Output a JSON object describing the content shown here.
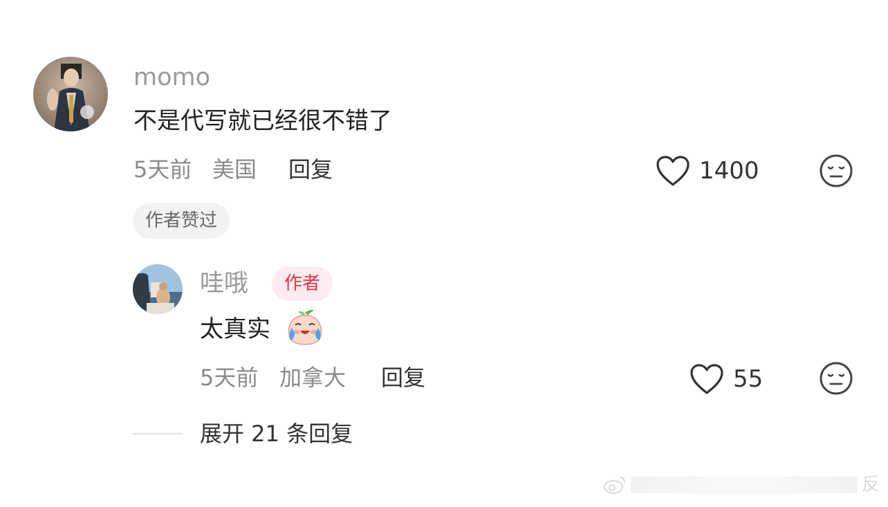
{
  "comment": {
    "username": "momo",
    "text": "不是代写就已经很不错了",
    "time": "5天前",
    "location": "美国",
    "reply_label": "回复",
    "like_count": "1400",
    "author_liked_badge": "作者赞过"
  },
  "reply": {
    "username": "哇哦",
    "author_badge": "作者",
    "text": "太真实",
    "time": "5天前",
    "location": "加拿大",
    "reply_label": "回复",
    "like_count": "55"
  },
  "expand_replies": {
    "label": "展开 21 条回复"
  },
  "icons": {
    "like": "heart-outline-icon",
    "dislike": "neutral-face-icon",
    "emoji": "crying-laughing-peach-emoji"
  },
  "colors": {
    "author_badge_text": "#e5334b",
    "author_badge_bg": "#fdecef",
    "secondary_text": "#8a8a8a"
  },
  "watermark": {
    "text": "反"
  }
}
